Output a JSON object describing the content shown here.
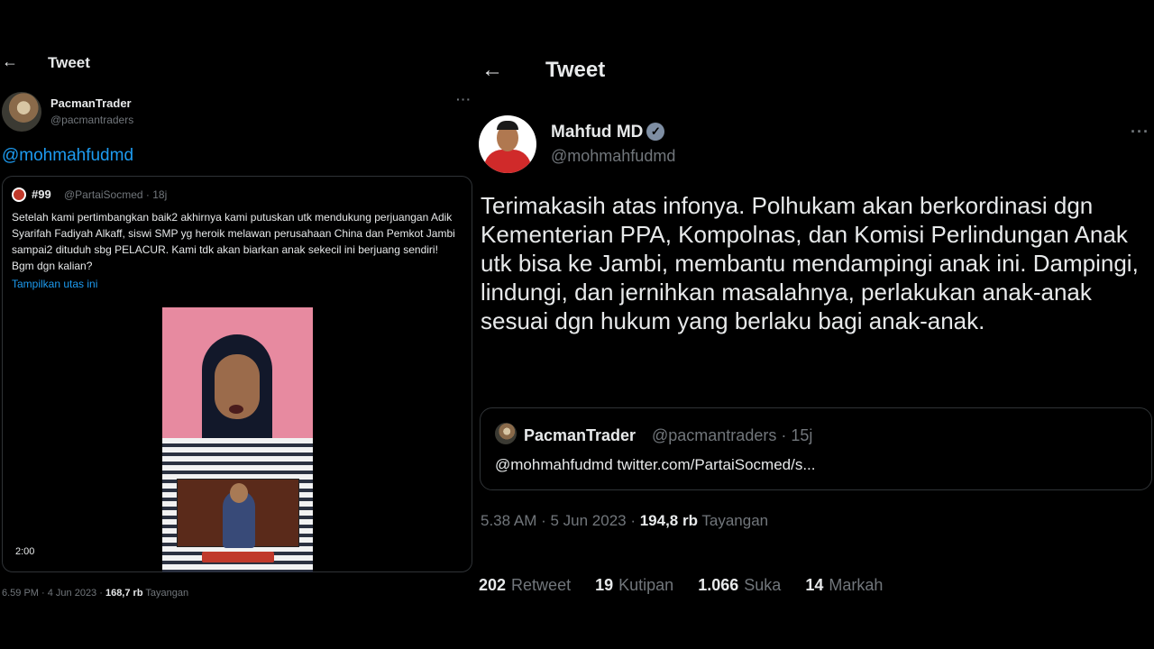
{
  "left": {
    "header": {
      "back_icon": "←",
      "title": "Tweet"
    },
    "author": {
      "name": "PacmanTrader",
      "handle": "@pacmantraders",
      "more_icon": "···"
    },
    "mention": "@mohmahfudmd",
    "quoted": {
      "name": "#99",
      "meta": "@PartaiSocmed · 18j",
      "text": "Setelah kami pertimbangkan baik2 akhirnya kami putuskan utk mendukung perjuangan Adik Syarifah Fadiyah Alkaff, siswi SMP yg heroik melawan perusahaan China dan Pemkot Jambi sampai2 dituduh sbg PELACUR. Kami tdk akan biarkan anak sekecil ini berjuang sendiri! Bgm dgn kalian?",
      "show_thread": "Tampilkan utas ini",
      "video_duration": "2:00"
    },
    "footer": {
      "time": "6.59 PM · 4 Jun 2023 · ",
      "views": "168,7 rb",
      "views_label": " Tayangan"
    }
  },
  "right": {
    "header": {
      "back_icon": "←",
      "title": "Tweet"
    },
    "author": {
      "name": "Mahfud MD",
      "verified_icon": "✓",
      "handle": "@mohmahfudmd",
      "more_icon": "···"
    },
    "text": "Terimakasih atas infonya. Polhukam akan berkordinasi dgn Kementerian PPA, Kompolnas, dan Komisi Perlindungan Anak utk bisa ke Jambi, membantu mendampingi anak ini. Dampingi, lindungi, dan jernihkan masalahnya, perlakukan anak-anak sesuai dgn hukum yang berlaku bagi anak-anak.",
    "quote": {
      "name": "PacmanTrader",
      "meta": "@pacmantraders · 15j",
      "text": "@mohmahfudmd twitter.com/PartaiSocmed/s..."
    },
    "footer": {
      "time": "5.38 AM · 5 Jun 2023 · ",
      "views": "194,8 rb",
      "views_label": " Tayangan"
    },
    "stats": {
      "retweets": "202",
      "retweets_label": "Retweet",
      "quotes": "19",
      "quotes_label": "Kutipan",
      "likes": "1.066",
      "likes_label": "Suka",
      "bookmarks": "14",
      "bookmarks_label": "Markah"
    }
  },
  "colors": {
    "background": "#000000",
    "text": "#e7e9ea",
    "muted": "#71767b",
    "link": "#1d9bf0",
    "border": "#2f3336"
  }
}
